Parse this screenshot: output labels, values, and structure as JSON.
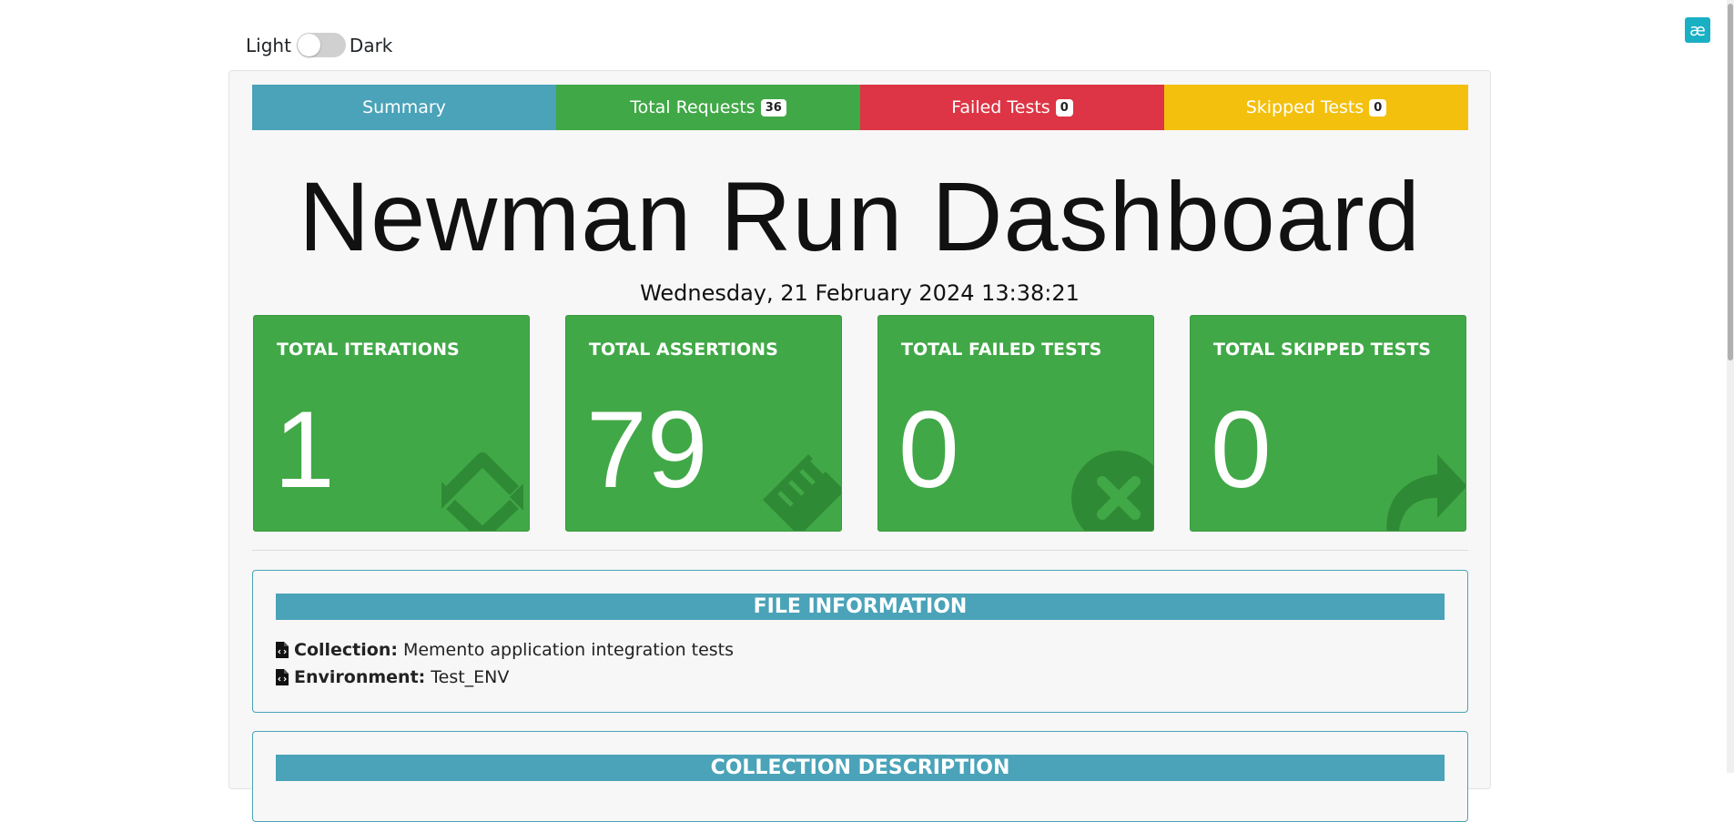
{
  "theme": {
    "light_label": "Light",
    "dark_label": "Dark",
    "toggle_state": "light"
  },
  "corner_logo": {
    "glyph": "æ"
  },
  "tabs": [
    {
      "label": "Summary",
      "badge": null
    },
    {
      "label": "Total Requests",
      "badge": "36"
    },
    {
      "label": "Failed Tests",
      "badge": "0"
    },
    {
      "label": "Skipped Tests",
      "badge": "0"
    }
  ],
  "title": "Newman Run Dashboard",
  "date": "Wednesday, 21 February 2024 13:38:21",
  "stats": [
    {
      "label": "TOTAL ITERATIONS",
      "value": "1",
      "icon": "refresh-icon"
    },
    {
      "label": "TOTAL ASSERTIONS",
      "value": "79",
      "icon": "ruler-icon"
    },
    {
      "label": "TOTAL FAILED TESTS",
      "value": "0",
      "icon": "times-circle-icon"
    },
    {
      "label": "TOTAL SKIPPED TESTS",
      "value": "0",
      "icon": "share-arrow-icon"
    }
  ],
  "file_info": {
    "header": "FILE INFORMATION",
    "collection_label": "Collection:",
    "collection_value": "Memento application integration tests",
    "environment_label": "Environment:",
    "environment_value": "Test_ENV"
  },
  "collection_description": {
    "header": "COLLECTION DESCRIPTION"
  },
  "colors": {
    "summary": "#4aa3b8",
    "requests": "#41a847",
    "failed": "#dd3545",
    "skipped": "#f4c00e",
    "card": "#41a847"
  }
}
